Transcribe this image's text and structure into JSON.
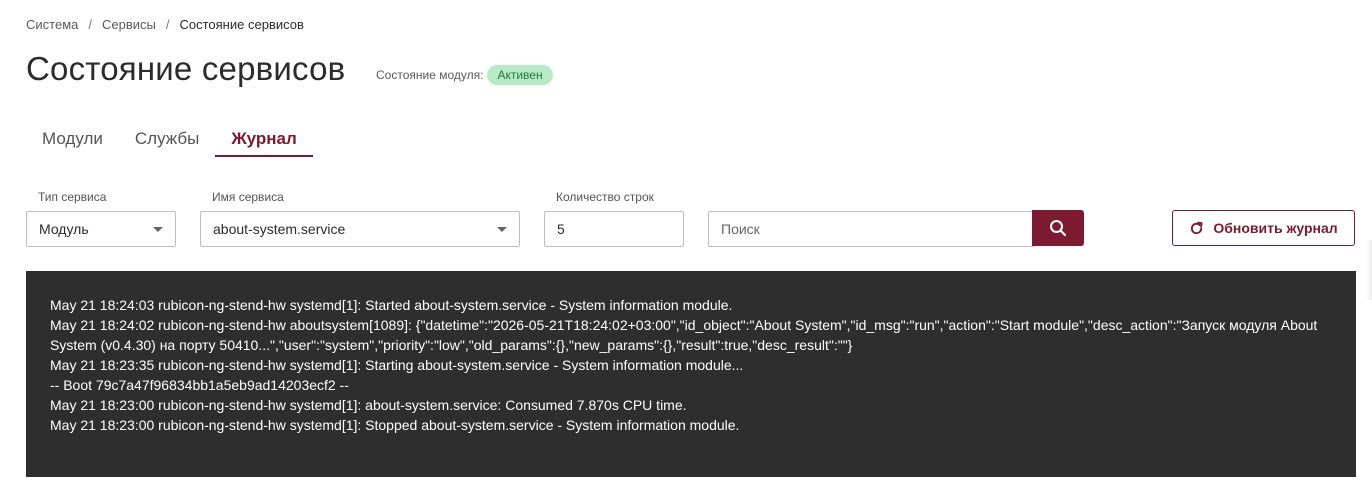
{
  "breadcrumb": {
    "items": [
      "Система",
      "Сервисы",
      "Состояние сервисов"
    ],
    "separator": "/"
  },
  "page": {
    "title": "Состояние сервисов",
    "module_state_label": "Состояние модуля:",
    "module_state_value": "Активен"
  },
  "tabs": [
    {
      "label": "Модули",
      "active": false
    },
    {
      "label": "Службы",
      "active": false
    },
    {
      "label": "Журнал",
      "active": true
    }
  ],
  "filters": {
    "service_type": {
      "label": "Тип сервиса",
      "value": "Модуль"
    },
    "service_name": {
      "label": "Имя сервиса",
      "value": "about-system.service"
    },
    "lines_count": {
      "label": "Количество строк",
      "value": "5"
    },
    "search": {
      "placeholder": "Поиск",
      "value": ""
    }
  },
  "actions": {
    "refresh_label": "Обновить журнал",
    "search_icon": "search-icon",
    "refresh_icon": "refresh-icon"
  },
  "log": {
    "lines": [
      "May 21 18:24:03 rubicon-ng-stend-hw systemd[1]: Started about-system.service - System information module.",
      "May 21 18:24:02 rubicon-ng-stend-hw aboutsystem[1089]: {\"datetime\":\"2026-05-21T18:24:02+03:00\",\"id_object\":\"About System\",\"id_msg\":\"run\",\"action\":\"Start module\",\"desc_action\":\"Запуск модуля About System (v0.4.30) на порту 50410...\",\"user\":\"system\",\"priority\":\"low\",\"old_params\":{},\"new_params\":{},\"result\":true,\"desc_result\":\"\"}",
      "May 21 18:23:35 rubicon-ng-stend-hw systemd[1]: Starting about-system.service - System information module...",
      "-- Boot 79c7a47f96834bb1a5eb9ad14203ecf2 --",
      "May 21 18:23:00 rubicon-ng-stend-hw systemd[1]: about-system.service: Consumed 7.870s CPU time.",
      "May 21 18:23:00 rubicon-ng-stend-hw systemd[1]: Stopped about-system.service - System information module."
    ]
  },
  "colors": {
    "accent": "#7b1a30",
    "badge_bg": "#b9eac7",
    "badge_text": "#1f7a3a",
    "log_bg": "#2e2e2e"
  }
}
